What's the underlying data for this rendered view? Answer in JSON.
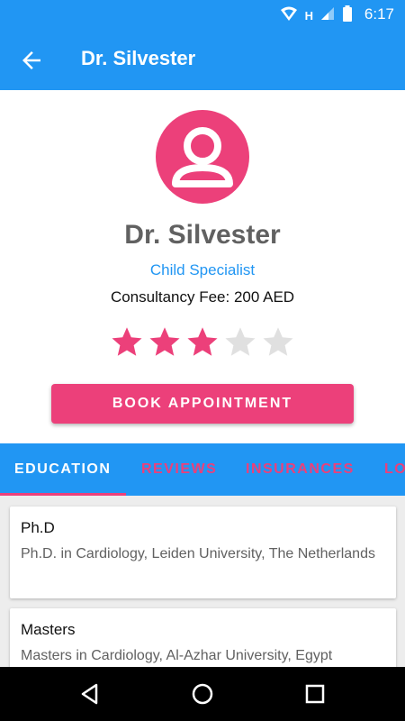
{
  "status_bar": {
    "time": "6:17",
    "network_label": "H"
  },
  "app_bar": {
    "title": "Dr. Silvester"
  },
  "profile": {
    "name": "Dr. Silvester",
    "specialty": "Child Specialist",
    "fee": "Consultancy Fee: 200 AED",
    "rating": 3,
    "rating_max": 5,
    "book_button": "BOOK APPOINTMENT"
  },
  "tabs": [
    {
      "label": "EDUCATION",
      "active": true
    },
    {
      "label": "REVIEWS",
      "active": false
    },
    {
      "label": "INSURANCES",
      "active": false
    },
    {
      "label": "LO",
      "active": false
    }
  ],
  "education": [
    {
      "title": "Ph.D",
      "description": "Ph.D. in Cardiology, Leiden University, The Netherlands"
    },
    {
      "title": "Masters",
      "description": "Masters in Cardiology, Al-Azhar University, Egypt"
    }
  ],
  "colors": {
    "primary": "#2196F3",
    "accent": "#EC407A",
    "star_empty": "#E0E0E0",
    "text_gray": "#616161"
  },
  "icons": {
    "back": "arrow-back-icon",
    "avatar": "account-circle-icon",
    "nav_back": "triangle-back-icon",
    "nav_home": "circle-home-icon",
    "nav_recents": "square-recents-icon"
  }
}
